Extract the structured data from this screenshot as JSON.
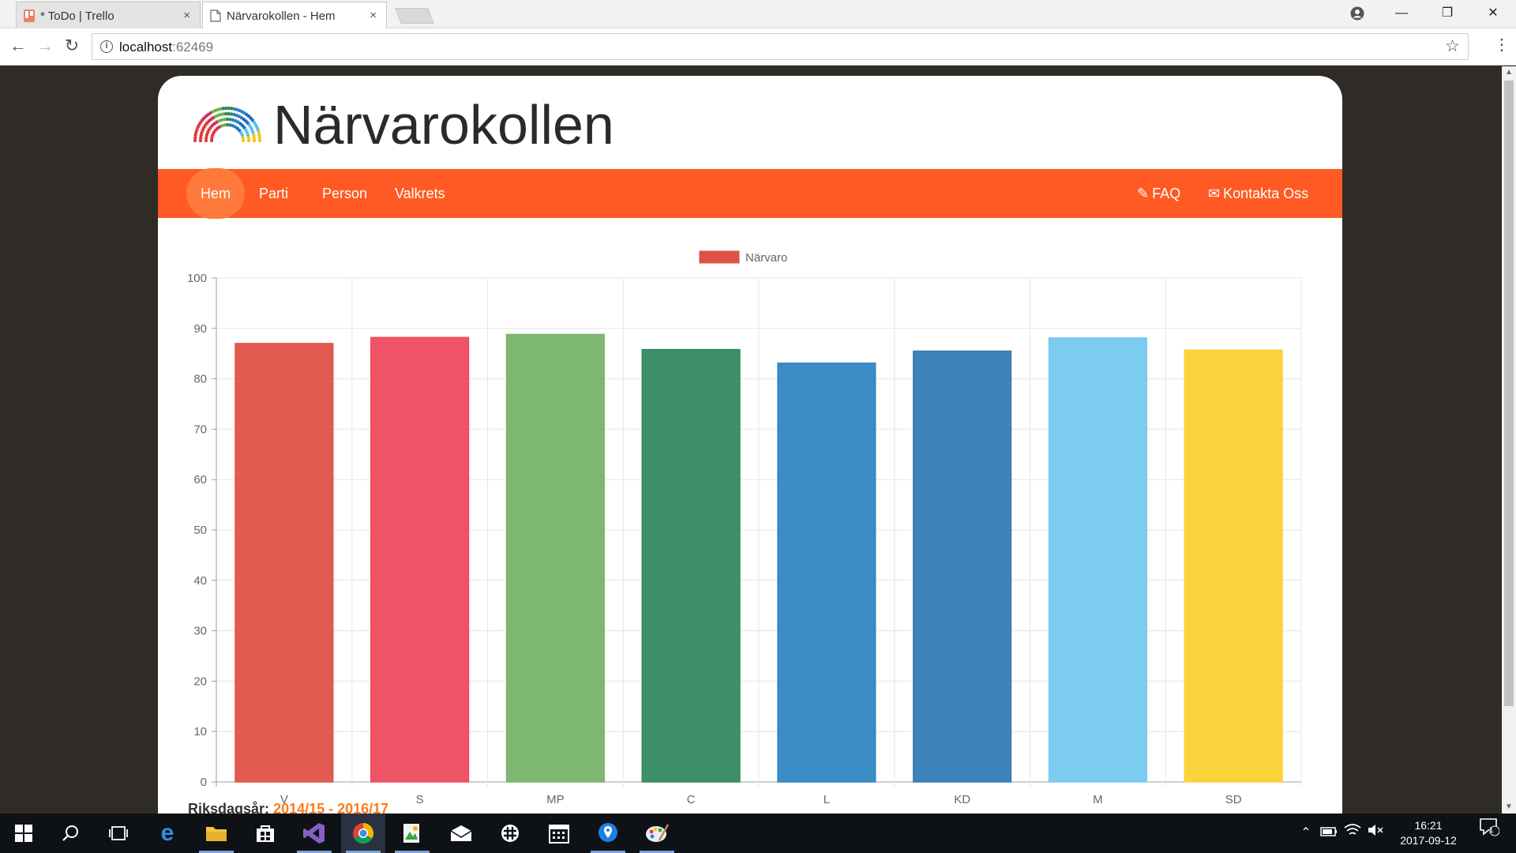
{
  "browser": {
    "tabs": [
      {
        "title": "* ToDo | Trello",
        "close": "×",
        "active": false
      },
      {
        "title": "Närvarokollen - Hem",
        "close": "×",
        "active": true
      }
    ],
    "window_controls": {
      "minimize": "—",
      "maximize": "❐",
      "close": "✕"
    },
    "nav": {
      "back": "←",
      "forward": "→",
      "reload": "↻"
    },
    "url_host": "localhost",
    "url_port": ":62469",
    "bookmark": "☆",
    "menu": "⋮"
  },
  "site": {
    "title": "Närvarokollen",
    "nav": {
      "left": [
        {
          "label": "Hem",
          "active": true
        },
        {
          "label": "Parti",
          "active": false
        },
        {
          "label": "Person",
          "active": false
        },
        {
          "label": "Valkrets",
          "active": false
        }
      ],
      "faq": {
        "label": "FAQ",
        "icon": "pencil-icon",
        "glyph": "✎"
      },
      "contact": {
        "label": "Kontakta Oss",
        "icon": "envelope-icon",
        "glyph": "✉"
      }
    },
    "footnote": {
      "label": "Riksdagsår:",
      "value": "2014/15 - 2016/17"
    }
  },
  "chart_data": {
    "type": "bar",
    "categories": [
      "V",
      "S",
      "MP",
      "C",
      "L",
      "KD",
      "M",
      "SD"
    ],
    "series": [
      {
        "name": "Närvaro",
        "values": [
          87,
          88.2,
          88.8,
          85.8,
          83.1,
          85.5,
          88.1,
          85.7
        ]
      }
    ],
    "bar_colors": [
      "#df5247",
      "#ee4a5e",
      "#77b36a",
      "#31895f",
      "#3286c2",
      "#347cb6",
      "#75c9ee",
      "#fad233"
    ],
    "legend_color": "#df5247",
    "ylim": [
      0,
      100
    ],
    "yticks": [
      0,
      10,
      20,
      30,
      40,
      50,
      60,
      70,
      80,
      90,
      100
    ],
    "grid": true,
    "legend_position": "top"
  },
  "taskbar": {
    "clock_time": "16:21",
    "clock_date": "2017-09-12",
    "notification_count": "1"
  }
}
